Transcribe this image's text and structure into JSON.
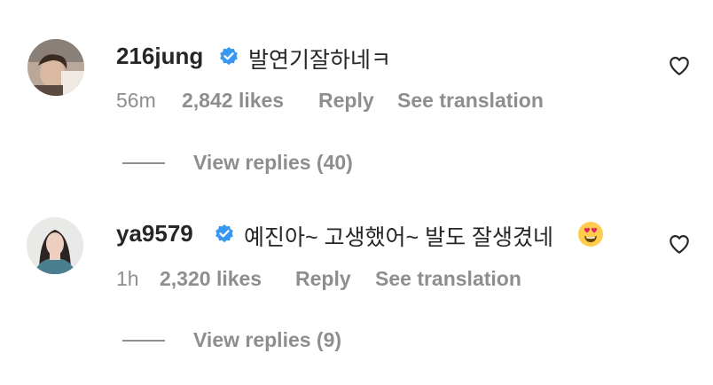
{
  "comments": [
    {
      "username": "216jung",
      "text": "발연기잘하네ㅋ",
      "time": "56m",
      "likes": "2,842 likes",
      "reply_label": "Reply",
      "translate_label": "See translation",
      "view_replies": "View replies (40)"
    },
    {
      "username": "ya9579",
      "text": "예진아~ 고생했어~ 발도 잘생겼네",
      "time": "1h",
      "likes": "2,320 likes",
      "reply_label": "Reply",
      "translate_label": "See translation",
      "view_replies": "View replies (9)"
    }
  ],
  "colors": {
    "verified_badge": "#3897f0",
    "secondary_text": "#8e8e8e",
    "primary_text": "#262626"
  },
  "icons": {
    "verified": "verified-badge-icon",
    "like": "heart-icon",
    "emoji": "heart-eyes-emoji"
  }
}
